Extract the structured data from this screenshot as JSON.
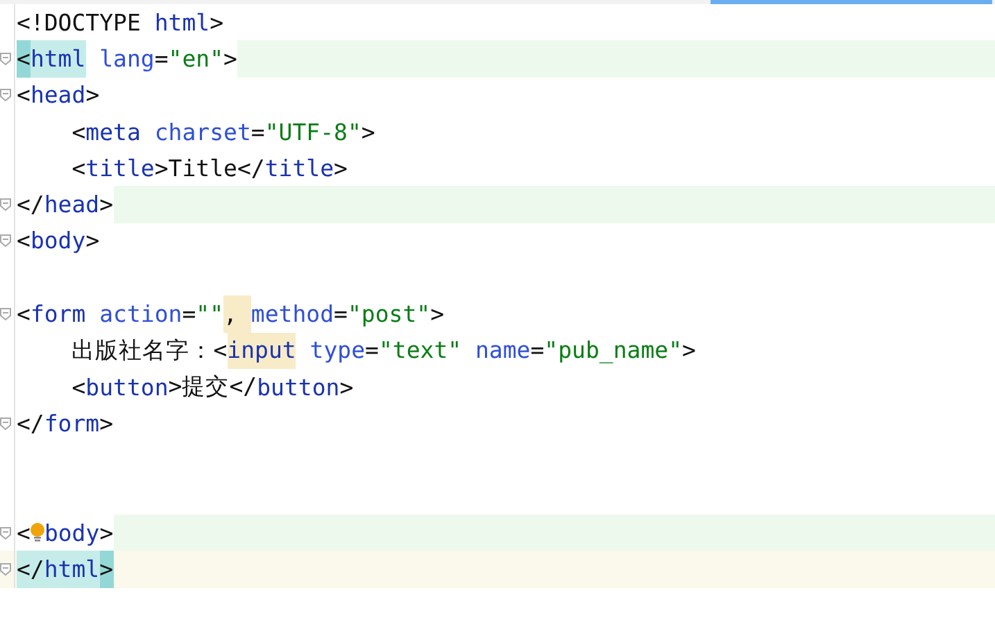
{
  "editor": {
    "lines": [
      {
        "fold": false,
        "tokens": [
          {
            "kind": "punct",
            "text": "<!DOCTYPE "
          },
          {
            "kind": "tag",
            "text": "html"
          },
          {
            "kind": "punct",
            "text": ">"
          }
        ]
      },
      {
        "fold": true,
        "highlighted": true,
        "tokens": [
          {
            "kind": "punct",
            "text": "<",
            "bracket_match": true
          },
          {
            "kind": "tag",
            "text": "html",
            "matched": true
          },
          {
            "kind": "attr",
            "text": " lang"
          },
          {
            "kind": "punct",
            "text": "="
          },
          {
            "kind": "string",
            "text": "\"en\""
          },
          {
            "kind": "punct",
            "text": ">"
          }
        ]
      },
      {
        "fold": true,
        "tokens": [
          {
            "kind": "punct",
            "text": "<"
          },
          {
            "kind": "tag",
            "text": "head"
          },
          {
            "kind": "punct",
            "text": ">"
          }
        ]
      },
      {
        "fold": false,
        "tokens": [
          {
            "kind": "punct",
            "text": "    <"
          },
          {
            "kind": "tag",
            "text": "meta"
          },
          {
            "kind": "attr",
            "text": " charset"
          },
          {
            "kind": "punct",
            "text": "="
          },
          {
            "kind": "string",
            "text": "\"UTF-8\""
          },
          {
            "kind": "punct",
            "text": ">"
          }
        ]
      },
      {
        "fold": false,
        "tokens": [
          {
            "kind": "punct",
            "text": "    <"
          },
          {
            "kind": "tag",
            "text": "title"
          },
          {
            "kind": "punct",
            "text": ">Title</"
          },
          {
            "kind": "tag",
            "text": "title"
          },
          {
            "kind": "punct",
            "text": ">"
          }
        ]
      },
      {
        "fold": true,
        "highlighted": true,
        "tokens": [
          {
            "kind": "punct",
            "text": "</"
          },
          {
            "kind": "tag",
            "text": "head"
          },
          {
            "kind": "punct",
            "text": ">"
          }
        ]
      },
      {
        "fold": true,
        "tokens": [
          {
            "kind": "punct",
            "text": "<"
          },
          {
            "kind": "tag",
            "text": "body"
          },
          {
            "kind": "punct",
            "text": ">"
          }
        ]
      },
      {
        "fold": false
      },
      {
        "fold": true,
        "tokens": [
          {
            "kind": "punct",
            "text": "<"
          },
          {
            "kind": "tag",
            "text": "form"
          },
          {
            "kind": "attr",
            "text": " action"
          },
          {
            "kind": "punct",
            "text": "="
          },
          {
            "kind": "string",
            "text": "\"\""
          },
          {
            "kind": "punct",
            "text": ", ",
            "warning": true
          },
          {
            "kind": "attr",
            "text": "method"
          },
          {
            "kind": "punct",
            "text": "="
          },
          {
            "kind": "string",
            "text": "\"post\""
          },
          {
            "kind": "punct",
            "text": ">"
          }
        ]
      },
      {
        "fold": false,
        "tokens": [
          {
            "kind": "punct",
            "text": "    出版社名字：<"
          },
          {
            "kind": "tag",
            "text": "input",
            "warning": true
          },
          {
            "kind": "attr",
            "text": " type"
          },
          {
            "kind": "punct",
            "text": "="
          },
          {
            "kind": "string",
            "text": "\"text\""
          },
          {
            "kind": "attr",
            "text": " name"
          },
          {
            "kind": "punct",
            "text": "="
          },
          {
            "kind": "string",
            "text": "\"pub_name\""
          },
          {
            "kind": "punct",
            "text": ">"
          }
        ]
      },
      {
        "fold": false,
        "tokens": [
          {
            "kind": "punct",
            "text": "    <"
          },
          {
            "kind": "tag",
            "text": "button"
          },
          {
            "kind": "punct",
            "text": ">提交</"
          },
          {
            "kind": "tag",
            "text": "button"
          },
          {
            "kind": "punct",
            "text": ">"
          }
        ]
      },
      {
        "fold": true,
        "tokens": [
          {
            "kind": "punct",
            "text": "</"
          },
          {
            "kind": "tag",
            "text": "form"
          },
          {
            "kind": "punct",
            "text": ">"
          }
        ]
      },
      {
        "fold": false
      },
      {
        "fold": false
      },
      {
        "fold": true,
        "highlighted": true,
        "tokens": [
          {
            "kind": "punct",
            "text": "<"
          },
          {
            "kind": "bulb"
          },
          {
            "kind": "tag",
            "text": "body"
          },
          {
            "kind": "punct",
            "text": ">"
          }
        ]
      },
      {
        "fold": true,
        "current": true,
        "tokens": [
          {
            "kind": "punct",
            "text": "</",
            "matched": true
          },
          {
            "kind": "tag",
            "text": "html",
            "matched": true
          },
          {
            "kind": "punct",
            "text": ">",
            "bracket_match": true
          }
        ]
      }
    ]
  }
}
